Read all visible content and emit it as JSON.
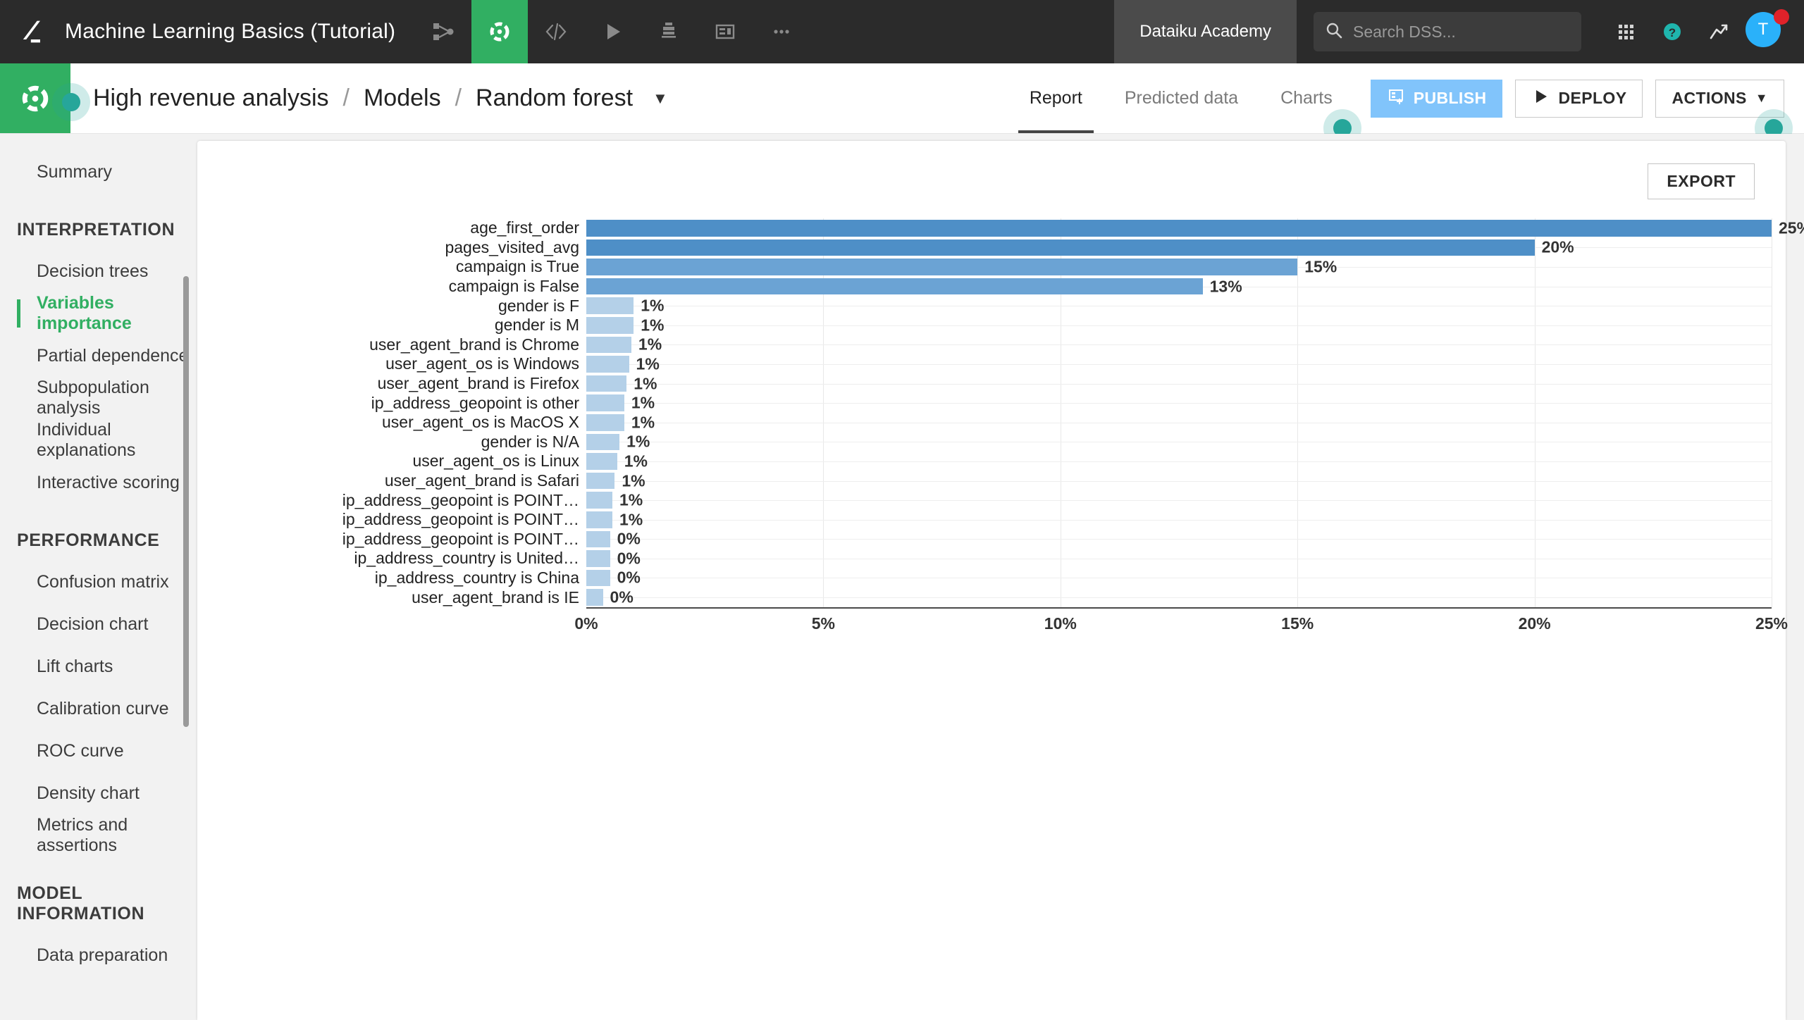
{
  "topbar": {
    "project_title": "Machine Learning Basics (Tutorial)",
    "icons": [
      {
        "name": "flow-icon",
        "label": "Flow"
      },
      {
        "name": "lab-icon",
        "label": "Lab"
      },
      {
        "name": "code-icon",
        "label": "Code"
      },
      {
        "name": "jobs-icon",
        "label": "Jobs"
      },
      {
        "name": "automation-icon",
        "label": "Automation"
      },
      {
        "name": "dashboards-icon",
        "label": "Dashboards"
      },
      {
        "name": "more-icon",
        "label": "More"
      }
    ],
    "academy_label": "Dataiku Academy",
    "search_placeholder": "Search DSS...",
    "search_value": "",
    "avatar_initial": "T"
  },
  "subheader": {
    "breadcrumb": [
      {
        "label": "High revenue analysis"
      },
      {
        "label": "Models"
      },
      {
        "label": "Random forest"
      }
    ],
    "separator": "/",
    "tabs": [
      {
        "label": "Report",
        "active": true
      },
      {
        "label": "Predicted data",
        "active": false
      },
      {
        "label": "Charts",
        "active": false
      }
    ],
    "buttons": {
      "publish": "PUBLISH",
      "deploy": "DEPLOY",
      "actions": "ACTIONS"
    }
  },
  "sidebar": {
    "top_items": [
      {
        "label": "Summary",
        "active": false
      }
    ],
    "sections": [
      {
        "title": "INTERPRETATION",
        "items": [
          {
            "label": "Decision trees",
            "active": false
          },
          {
            "label": "Variables importance",
            "active": true
          },
          {
            "label": "Partial dependence",
            "active": false
          },
          {
            "label": "Subpopulation analysis",
            "active": false
          },
          {
            "label": "Individual explanations",
            "active": false
          },
          {
            "label": "Interactive scoring",
            "active": false
          }
        ]
      },
      {
        "title": "PERFORMANCE",
        "items": [
          {
            "label": "Confusion matrix",
            "active": false
          },
          {
            "label": "Decision chart",
            "active": false
          },
          {
            "label": "Lift charts",
            "active": false
          },
          {
            "label": "Calibration curve",
            "active": false
          },
          {
            "label": "ROC curve",
            "active": false
          },
          {
            "label": "Density chart",
            "active": false
          },
          {
            "label": "Metrics and assertions",
            "active": false
          }
        ]
      },
      {
        "title": "MODEL INFORMATION",
        "items": [
          {
            "label": "Data preparation",
            "active": false
          }
        ]
      }
    ]
  },
  "main": {
    "export_label": "EXPORT"
  },
  "colors": {
    "accent_green": "#31af62",
    "bar_blue": "#5b9bd1",
    "publish_blue": "#81c4fb",
    "hint_teal": "#26a69a"
  },
  "chart_data": {
    "type": "bar",
    "orientation": "horizontal",
    "title": "",
    "xlabel": "",
    "ylabel": "",
    "xlim": [
      0,
      25
    ],
    "xticks": [
      0,
      5,
      10,
      15,
      20,
      25
    ],
    "xticklabels": [
      "0%",
      "5%",
      "10%",
      "15%",
      "20%",
      "25%"
    ],
    "grid": true,
    "legend": "none",
    "categories": [
      "age_first_order",
      "pages_visited_avg",
      "campaign is True",
      "campaign is False",
      "gender is F",
      "gender is M",
      "user_agent_brand is Chrome",
      "user_agent_os is Windows",
      "user_agent_brand is Firefox",
      "ip_address_geopoint is other",
      "user_agent_os is MacOS X",
      "gender is N/A",
      "user_agent_os is Linux",
      "user_agent_brand is Safari",
      "ip_address_geopoint is POINT…",
      "ip_address_geopoint is POINT…",
      "ip_address_geopoint is POINT…",
      "ip_address_country is United…",
      "ip_address_country is China",
      "user_agent_brand is IE"
    ],
    "values": [
      25.0,
      20.0,
      15.0,
      13.0,
      1.0,
      1.0,
      0.95,
      0.9,
      0.85,
      0.8,
      0.8,
      0.7,
      0.65,
      0.6,
      0.55,
      0.55,
      0.5,
      0.5,
      0.5,
      0.35
    ],
    "value_labels": [
      "25%",
      "20%",
      "15%",
      "13%",
      "1%",
      "1%",
      "1%",
      "1%",
      "1%",
      "1%",
      "1%",
      "1%",
      "1%",
      "1%",
      "1%",
      "1%",
      "0%",
      "0%",
      "0%",
      "0%"
    ],
    "bar_colors": [
      "#4e8fc7",
      "#4e8fc7",
      "#6ba3d4",
      "#6ba3d4",
      "#b4d0e8",
      "#b4d0e8",
      "#b4d0e8",
      "#b4d0e8",
      "#b4d0e8",
      "#b4d0e8",
      "#b4d0e8",
      "#b4d0e8",
      "#b4d0e8",
      "#b4d0e8",
      "#b4d0e8",
      "#b4d0e8",
      "#b4d0e8",
      "#b4d0e8",
      "#b4d0e8",
      "#b4d0e8"
    ]
  }
}
